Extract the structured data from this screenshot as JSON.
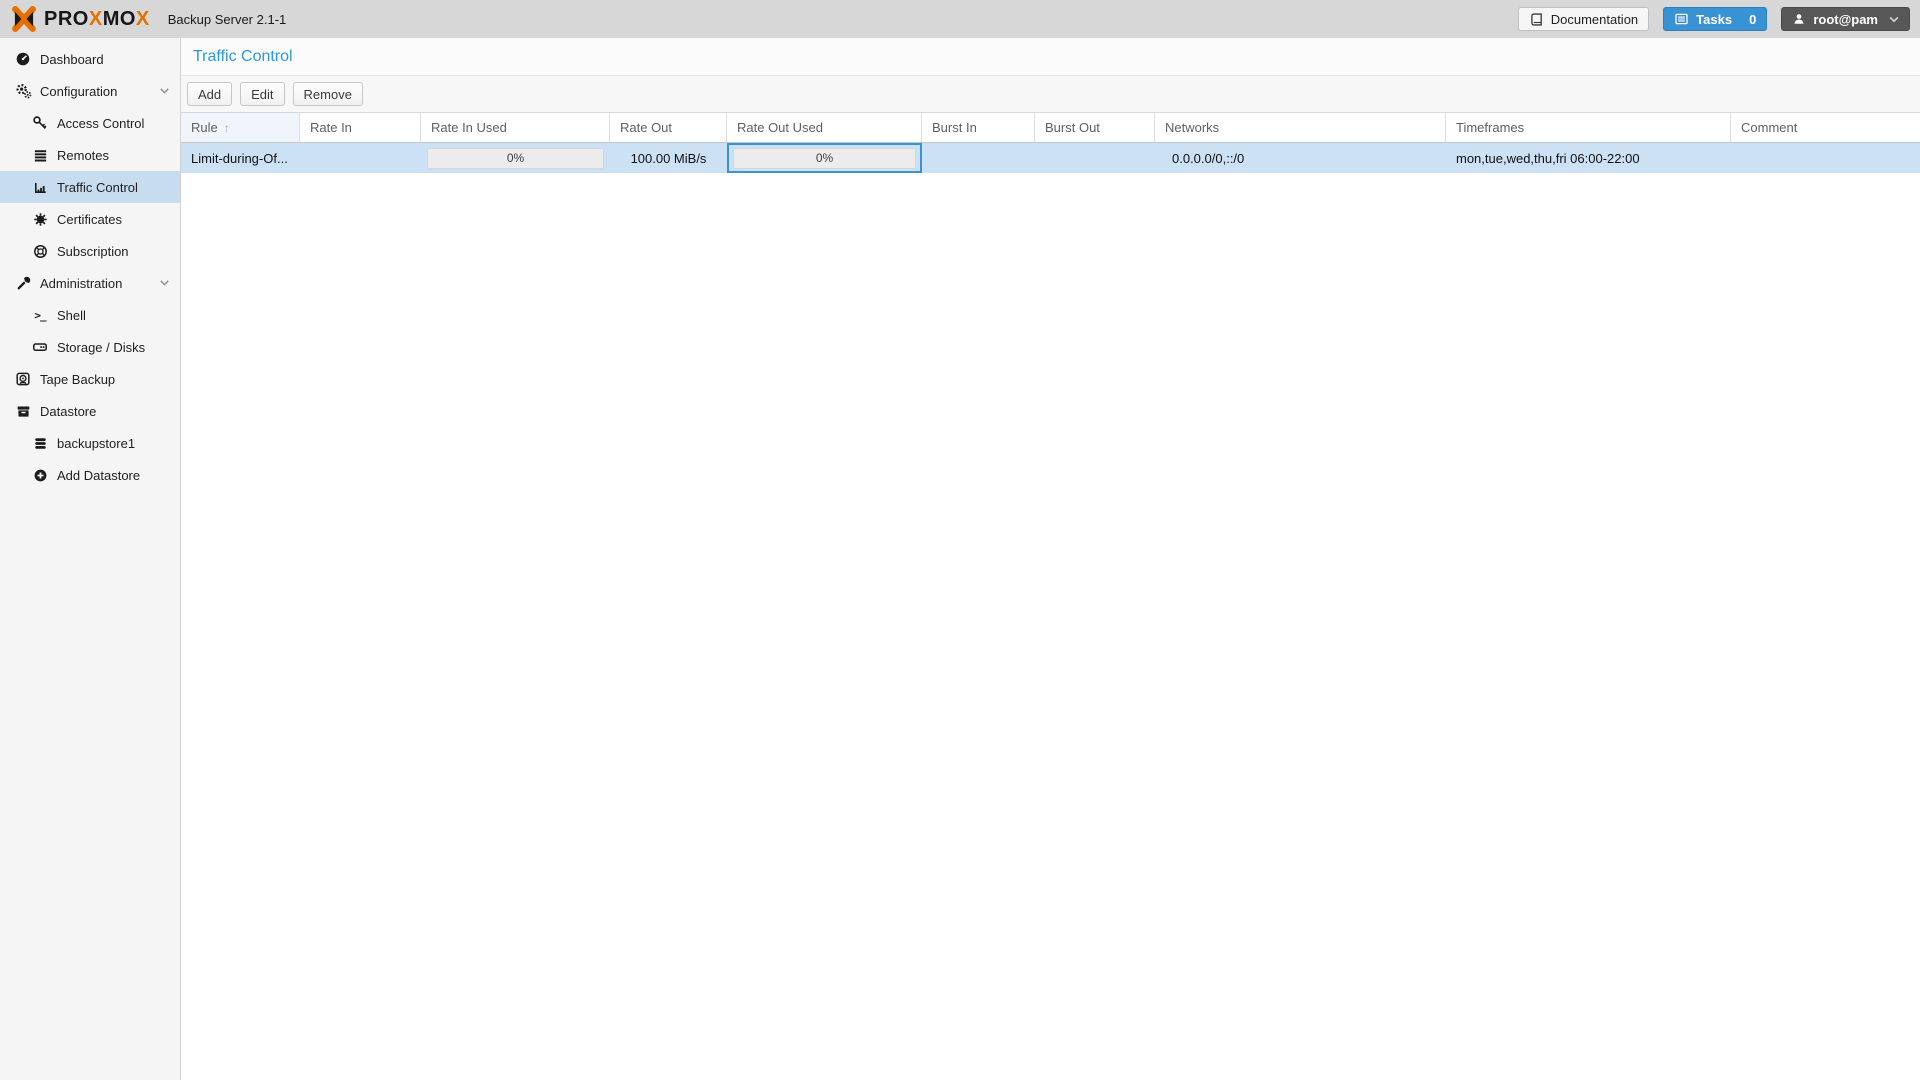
{
  "topbar": {
    "logo_segments": [
      {
        "text": "PRO",
        "accent": false
      },
      {
        "text": "X",
        "accent": true
      },
      {
        "text": "MO",
        "accent": false
      },
      {
        "text": "X",
        "accent": true
      }
    ],
    "subtitle": "Backup Server 2.1-1",
    "documentation_label": "Documentation",
    "tasks_label": "Tasks",
    "tasks_count": "0",
    "user_label": "root@pam",
    "icons": [
      "proxmox-logo-icon",
      "book-icon",
      "task-list-icon",
      "user-icon",
      "chevron-down-icon"
    ]
  },
  "sidebar": {
    "items": [
      {
        "label": "Dashboard",
        "icon": "dashboard-gauge-icon",
        "level": 0,
        "selected": false,
        "expandable": false
      },
      {
        "label": "Configuration",
        "icon": "gears-icon",
        "level": 0,
        "selected": false,
        "expandable": true
      },
      {
        "label": "Access Control",
        "icon": "key-icon",
        "level": 1,
        "selected": false,
        "expandable": false
      },
      {
        "label": "Remotes",
        "icon": "remotes-list-icon",
        "level": 1,
        "selected": false,
        "expandable": false
      },
      {
        "label": "Traffic Control",
        "icon": "bar-chart-icon",
        "level": 1,
        "selected": true,
        "expandable": false
      },
      {
        "label": "Certificates",
        "icon": "certificate-icon",
        "level": 1,
        "selected": false,
        "expandable": false
      },
      {
        "label": "Subscription",
        "icon": "life-ring-icon",
        "level": 1,
        "selected": false,
        "expandable": false
      },
      {
        "label": "Administration",
        "icon": "wrench-icon",
        "level": 0,
        "selected": false,
        "expandable": true
      },
      {
        "label": "Shell",
        "icon": "terminal-icon",
        "level": 1,
        "selected": false,
        "expandable": false
      },
      {
        "label": "Storage / Disks",
        "icon": "hdd-icon",
        "level": 1,
        "selected": false,
        "expandable": false
      },
      {
        "label": "Tape Backup",
        "icon": "tape-icon",
        "level": 0,
        "selected": false,
        "expandable": false
      },
      {
        "label": "Datastore",
        "icon": "archive-icon",
        "level": 0,
        "selected": false,
        "expandable": false
      },
      {
        "label": "backupstore1",
        "icon": "database-icon",
        "level": 1,
        "selected": false,
        "expandable": false
      },
      {
        "label": "Add Datastore",
        "icon": "plus-circle-icon",
        "level": 1,
        "selected": false,
        "expandable": false
      }
    ]
  },
  "panel": {
    "title": "Traffic Control",
    "toolbar": {
      "add_label": "Add",
      "edit_label": "Edit",
      "remove_label": "Remove"
    }
  },
  "table": {
    "columns": [
      {
        "label": "Rule",
        "sorted": "asc"
      },
      {
        "label": "Rate In"
      },
      {
        "label": "Rate In Used"
      },
      {
        "label": "Rate Out"
      },
      {
        "label": "Rate Out Used"
      },
      {
        "label": "Burst In"
      },
      {
        "label": "Burst Out"
      },
      {
        "label": "Networks"
      },
      {
        "label": "Timeframes"
      },
      {
        "label": "Comment"
      }
    ],
    "sort_icon": "↑",
    "rows": [
      {
        "rule": "Limit-during-Of...",
        "rate_in": "",
        "rate_in_used": "0%",
        "rate_out": "100.00 MiB/s",
        "rate_out_used": "0%",
        "burst_in": "",
        "burst_out": "",
        "networks": "0.0.0.0/0,::/0",
        "timeframes": "mon,tue,wed,thu,fri 06:00-22:00",
        "comment": "",
        "selected": true,
        "focused_cell": "rate_out_used"
      }
    ]
  },
  "colors": {
    "brand_orange": "#e57000",
    "accent_blue": "#3892d4",
    "topbar_bg": "#d7d7d7",
    "user_button_bg": "#585858",
    "row_selected_bg": "#cde1f4",
    "sidebar_selected_bg": "#c8dcf0",
    "sorted_header_bg": "#eff5fb"
  }
}
